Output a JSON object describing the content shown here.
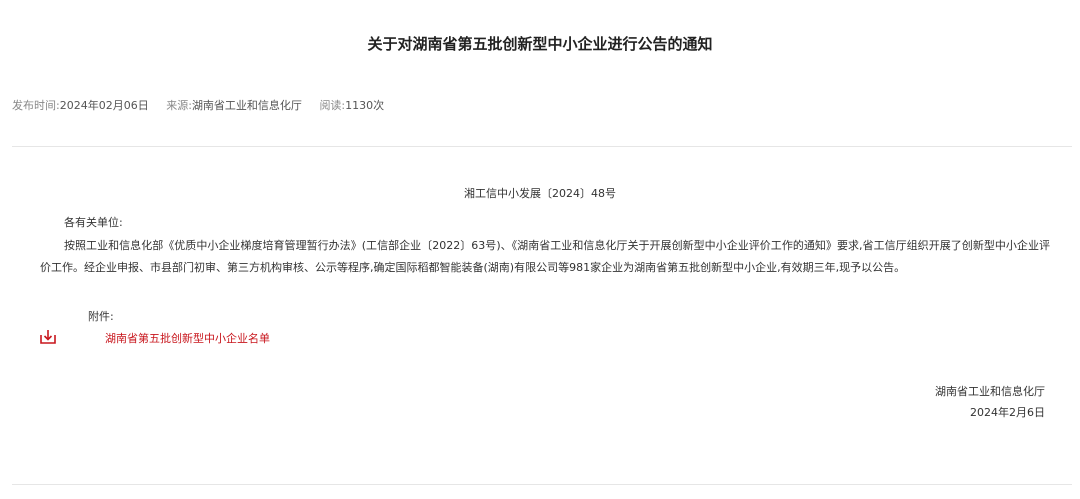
{
  "article": {
    "title": "关于对湖南省第五批创新型中小企业进行公告的通知",
    "meta": {
      "publish_label": "发布时间:",
      "publish_value": "2024年02月06日",
      "source_label": "来源:",
      "source_value": "湖南省工业和信息化厅",
      "views_label": "阅读:",
      "views_value": "1130次"
    },
    "doc_number": "湘工信中小发展〔2024〕48号",
    "addressee": "各有关单位:",
    "body": "按照工业和信息化部《优质中小企业梯度培育管理暂行办法》(工信部企业〔2022〕63号)、《湖南省工业和信息化厅关于开展创新型中小企业评价工作的通知》要求,省工信厅组织开展了创新型中小企业评价工作。经企业申报、市县部门初审、第三方机构审核、公示等程序,确定国际稻都智能装备(湖南)有限公司等981家企业为湖南省第五批创新型中小企业,有效期三年,现予以公告。",
    "attachment": {
      "label": "附件:",
      "icon": "download-icon",
      "link_text": "湖南省第五批创新型中小企业名单"
    },
    "signature": {
      "org": "湖南省工业和信息化厅",
      "date": "2024年2月6日"
    }
  },
  "colors": {
    "link": "#c8161d",
    "divider": "#e6e6e6"
  }
}
